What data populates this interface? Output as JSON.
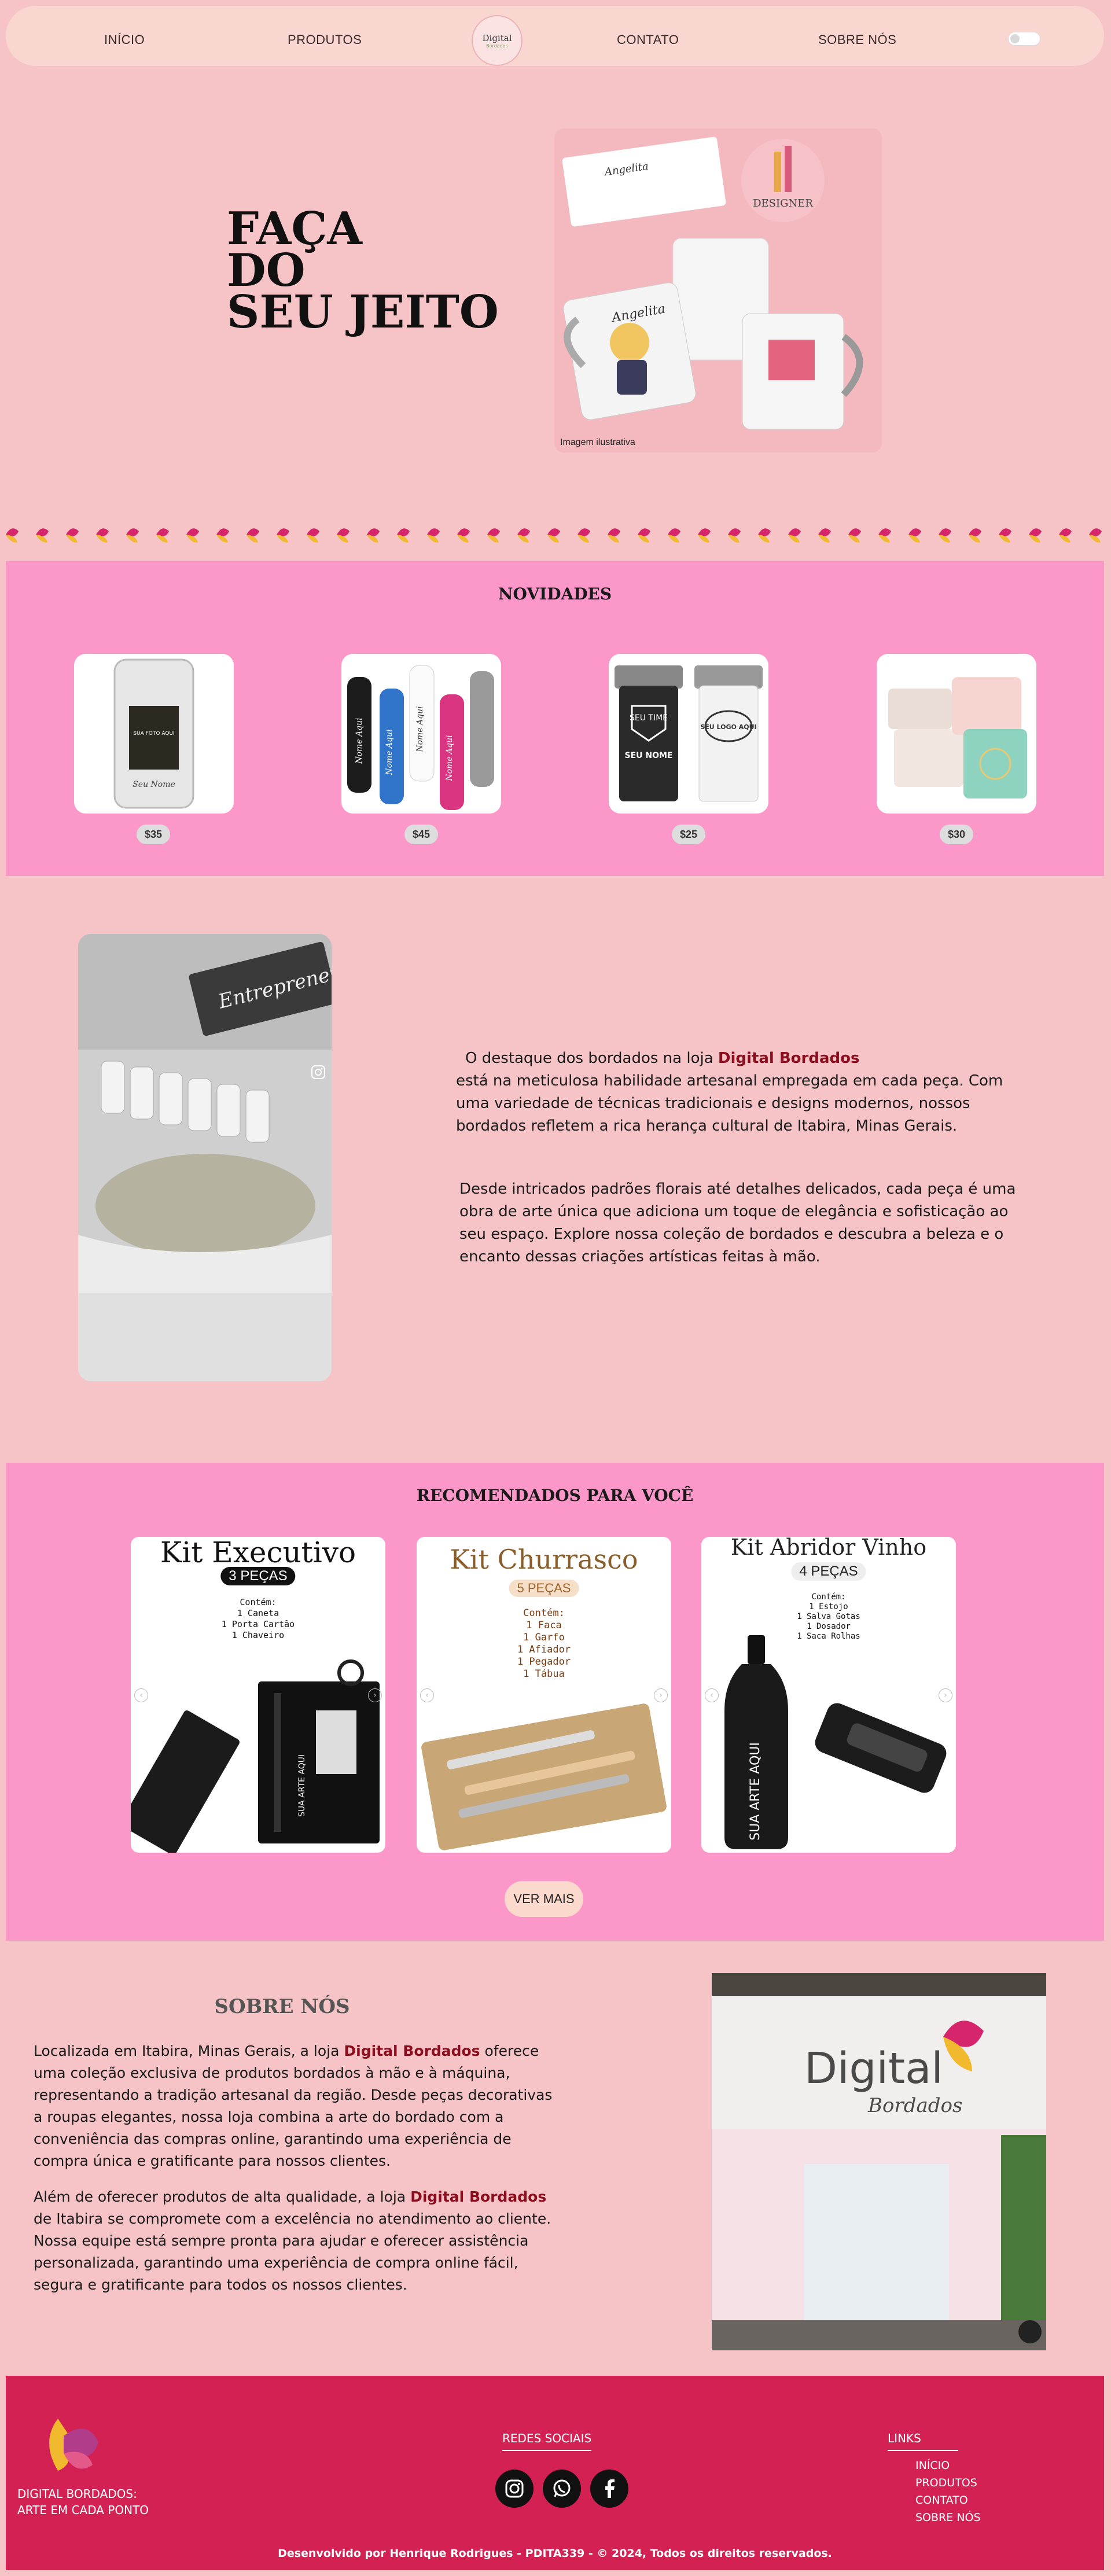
{
  "nav": {
    "items": [
      "INÍCIO",
      "PRODUTOS",
      "CONTATO",
      "SOBRE NÓS"
    ],
    "logo_title": "Digital",
    "logo_sub": "Bordados"
  },
  "hero": {
    "title_lines": [
      "FAÇA",
      "DO",
      "SEU JEITO"
    ],
    "image_caption": "Imagem ilustrativa",
    "mug_name": "Angelita",
    "badge_text": "DESIGNER"
  },
  "novidades": {
    "title": "NOVIDADES",
    "products": [
      {
        "name": "phone-case",
        "price": "$35",
        "case_text": "SUA FOTO AQUI",
        "case_name": "Seu Nome"
      },
      {
        "name": "bottles",
        "price": "$45",
        "bottle_texts": [
          "Nome Aqui",
          "Nome Aqui",
          "Nome Aqui",
          "Nome Aqui"
        ]
      },
      {
        "name": "tumblers",
        "price": "$25",
        "tumbler_texts": [
          "SEU TIME",
          "SEU NOME",
          "SEU LOGO AQUI"
        ]
      },
      {
        "name": "jewelry-boxes",
        "price": "$30"
      }
    ]
  },
  "embroidery": {
    "p1_prefix": "O destaque dos bordados na loja ",
    "brand": "Digital Bordados",
    "p1_rest": "está na meticulosa habilidade artesanal empregada em cada peça. Com uma variedade de técnicas tradicionais e designs modernos, nossos bordados refletem a rica herança cultural de Itabira, Minas Gerais.",
    "p2": "Desde intricados padrões florais até detalhes delicados, cada peça é uma obra de arte única que adiciona um toque de elegância e sofisticação ao seu espaço. Explore nossa coleção de bordados e descubra a beleza e o encanto dessas criações artísticas feitas à mão.",
    "video_label": "Entrepreneur"
  },
  "recomendados": {
    "title": "RECOMENDADOS PARA VOCÊ",
    "button": "VER MAIS",
    "kits": [
      {
        "title": "Kit Executivo",
        "badge": "3 PEÇAS",
        "contents": "Contém:\n1 Caneta\n1 Porta Cartão\n1 Chaveiro",
        "art": "SUA ARTE AQUI"
      },
      {
        "title": "Kit Churrasco",
        "badge": "5 PEÇAS",
        "contents": "Contém:\n1 Faca\n1 Garfo\n1 Afiador\n1 Pegador\n1 Tábua"
      },
      {
        "title": "Kit Abridor Vinho",
        "badge": "4 PEÇAS",
        "contents": "Contém:\n1 Estojo\n1 Salva Gotas\n1 Dosador\n1 Saca Rolhas",
        "art": "SUA ARTE AQUI"
      }
    ]
  },
  "about": {
    "title": "SOBRE NÓS",
    "p1_prefix": "Localizada em Itabira, Minas Gerais, a loja ",
    "brand": "Digital Bordados",
    "p1_rest": " oferece uma coleção exclusiva de produtos bordados à mão e à máquina, representando a tradição artesanal da região. Desde peças decorativas a roupas elegantes, nossa loja combina a arte do bordado com a conveniência das compras online, garantindo uma experiência de compra única e gratificante para nossos clientes.",
    "p2_prefix": "Além de oferecer produtos de alta qualidade, a loja ",
    "p2_rest": " de Itabira se compromete com a excelência no atendimento ao cliente. Nossa equipe está sempre pronta para ajudar e oferecer assistência personalizada, garantindo uma experiência de compra online fácil, segura e gratificante para todos os nossos clientes.",
    "store_sign_1": "Digital",
    "store_sign_2": "Bordados"
  },
  "footer": {
    "tagline_1": "DIGITAL BORDADOS:",
    "tagline_2": "ARTE EM CADA PONTO",
    "social_heading": "REDES SOCIAIS",
    "links_heading": "LINKS",
    "links": [
      "INÍCIO",
      "PRODUTOS",
      "CONTATO",
      "SOBRE NÓS"
    ],
    "copyright": "Desenvolvido por Henrique Rodrigues - PDITA339 - © 2024, Todos os direitos reservados."
  },
  "colors": {
    "page_bg": "#f6c4c6",
    "pink_section": "#fc98c9",
    "footer": "#d32154",
    "brand_text": "#8c0d1e"
  }
}
